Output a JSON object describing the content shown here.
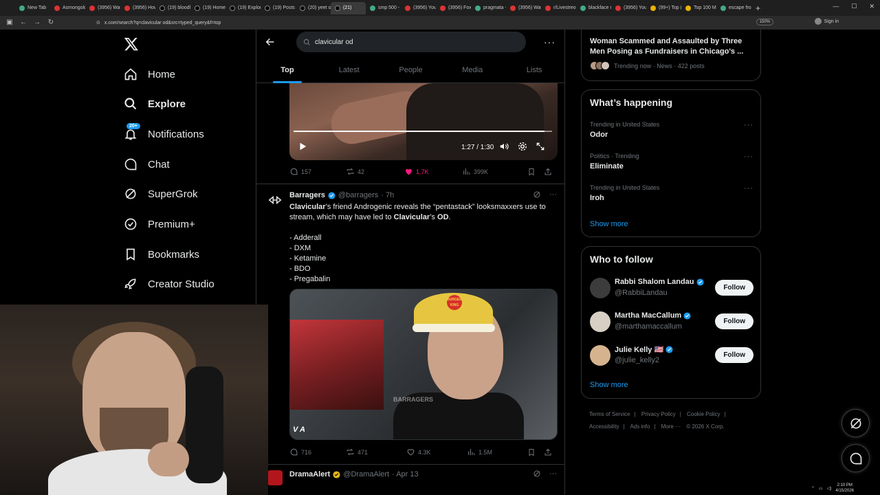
{
  "browser": {
    "tabs": [
      {
        "label": "New Tab",
        "fav": "g"
      },
      {
        "label": "Asmongold",
        "fav": "r"
      },
      {
        "label": "(3956) Wat",
        "fav": "r"
      },
      {
        "label": "(3956) How",
        "fav": "r"
      },
      {
        "label": "(19) bloodl",
        "fav": "x"
      },
      {
        "label": "(19) Home",
        "fav": "x"
      },
      {
        "label": "(19) Explor",
        "fav": "x"
      },
      {
        "label": "(19) Posts",
        "fav": "x"
      },
      {
        "label": "(20) yeet o",
        "fav": "x"
      },
      {
        "label": "(21)",
        "fav": "x",
        "active": true
      },
      {
        "label": "smp 500 -",
        "fav": "g"
      },
      {
        "label": "(3956) You",
        "fav": "r"
      },
      {
        "label": "(3956) Fox",
        "fav": "r"
      },
      {
        "label": "pragmata -",
        "fav": "g"
      },
      {
        "label": "(3956) Wat",
        "fav": "r"
      },
      {
        "label": "r/Livestreo",
        "fav": "r"
      },
      {
        "label": "blackface n",
        "fav": "g"
      },
      {
        "label": "(3956) You",
        "fav": "r"
      },
      {
        "label": "(99+) Top (",
        "fav": "y"
      },
      {
        "label": "Top 100 M",
        "fav": "y"
      },
      {
        "label": "escape fro",
        "fav": "g"
      }
    ],
    "url": "x.com/search?q=clavicular od&src=typed_query&f=top",
    "zoom": "150%",
    "sign_in": "Sign in"
  },
  "leftnav": {
    "items": [
      {
        "label": "Home",
        "icon": "home-icon"
      },
      {
        "label": "Explore",
        "icon": "search-icon"
      },
      {
        "label": "Notifications",
        "icon": "bell-icon"
      },
      {
        "label": "Chat",
        "icon": "chat-icon"
      },
      {
        "label": "SuperGrok",
        "icon": "grok-icon"
      },
      {
        "label": "Premium+",
        "icon": "premium-icon"
      },
      {
        "label": "Bookmarks",
        "icon": "bookmark-icon"
      },
      {
        "label": "Creator Studio",
        "icon": "rocket-icon"
      }
    ],
    "notifications_badge": "20+"
  },
  "search": {
    "value": "clavicular od",
    "tabs": [
      "Top",
      "Latest",
      "People",
      "Media",
      "Lists"
    ]
  },
  "video1": {
    "time": "1:27 / 1:30",
    "progress": 0.97,
    "replies": "157",
    "reposts": "42",
    "likes": "1.7K",
    "views": "399K"
  },
  "post2": {
    "name": "Barragers",
    "handle": "@barragers",
    "time": "· 7h",
    "text_pre": "’s friend Androgenic reveals the “pentastack” looksmaxxers use to stream, which may have led to ",
    "text_kw1": "Clavicular",
    "text_kw2": "Clavicular",
    "text_post": "’s ",
    "text_kw3": "OD",
    "text_end": ".",
    "list": [
      "- Adderall",
      "- DXM",
      "- Ketamine",
      "- BDO",
      "- Pregabalin"
    ],
    "image_watermark": "BARRAGERS",
    "image_corner": "V A",
    "logo_text": "BURGER KING",
    "replies": "716",
    "reposts": "471",
    "likes": "4.3K",
    "views": "1.5M"
  },
  "post3": {
    "name": "DramaAlert",
    "handle": "@DramaAlert",
    "time": "· Apr 13"
  },
  "news": {
    "title": "Woman Scammed and Assaulted by Three Men Posing as Fundraisers in Chicago's ...",
    "meta": "Trending now · News · 422 posts"
  },
  "happening": {
    "title": "What’s happening",
    "trends": [
      {
        "context": "Trending in United States",
        "topic": "Odor"
      },
      {
        "context": "Politics · Trending",
        "topic": "Eliminate"
      },
      {
        "context": "Trending in United States",
        "topic": "Iroh"
      }
    ],
    "show_more": "Show more"
  },
  "who_to_follow": {
    "title": "Who to follow",
    "accounts": [
      {
        "name": "Rabbi Shalom Landau",
        "handle": "@RabbiLandau",
        "button": "Follow"
      },
      {
        "name": "Martha MacCallum",
        "handle": "@marthamaccallum",
        "button": "Follow"
      },
      {
        "name": "Julie Kelly 🇺🇸",
        "handle": "@julie_kelly2",
        "button": "Follow"
      }
    ],
    "show_more": "Show more"
  },
  "footer": {
    "links": [
      "Terms of Service",
      "|",
      "Privacy Policy",
      "|",
      "Cookie Policy",
      "|",
      "Accessibility",
      "|",
      "Ads info",
      "|",
      "More ···",
      "© 2026 X Corp."
    ]
  },
  "taskbar": {
    "time": "2:10 PM",
    "date": "4/15/2026"
  },
  "colors": {
    "accent": "#1d9bf0",
    "like": "#f91880",
    "background": "#000000"
  }
}
